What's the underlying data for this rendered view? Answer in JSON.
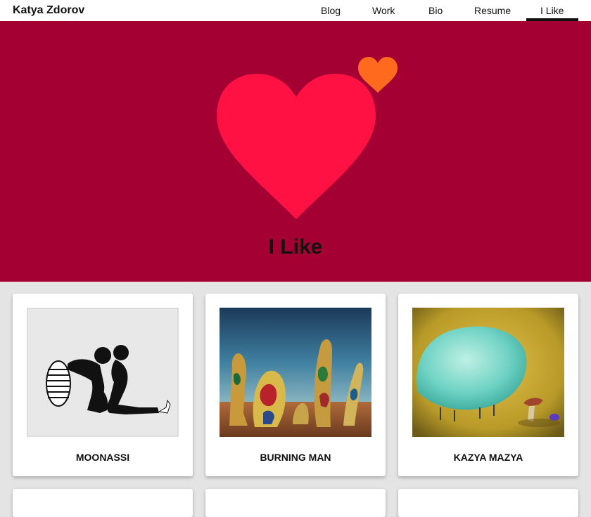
{
  "site": {
    "name": "Katya Zdorov"
  },
  "nav": {
    "items": [
      {
        "label": "Blog"
      },
      {
        "label": "Work"
      },
      {
        "label": "Bio"
      },
      {
        "label": "Resume"
      },
      {
        "label": "I Like",
        "active": true
      }
    ]
  },
  "hero": {
    "title": "I Like",
    "background": "#a50034",
    "big_heart_color": "#ff1144",
    "small_heart_color": "#ff6a1f"
  },
  "cards": [
    {
      "title": "MOONASSI"
    },
    {
      "title": "BURNING MAN"
    },
    {
      "title": "KAZYA MAZYA"
    }
  ]
}
